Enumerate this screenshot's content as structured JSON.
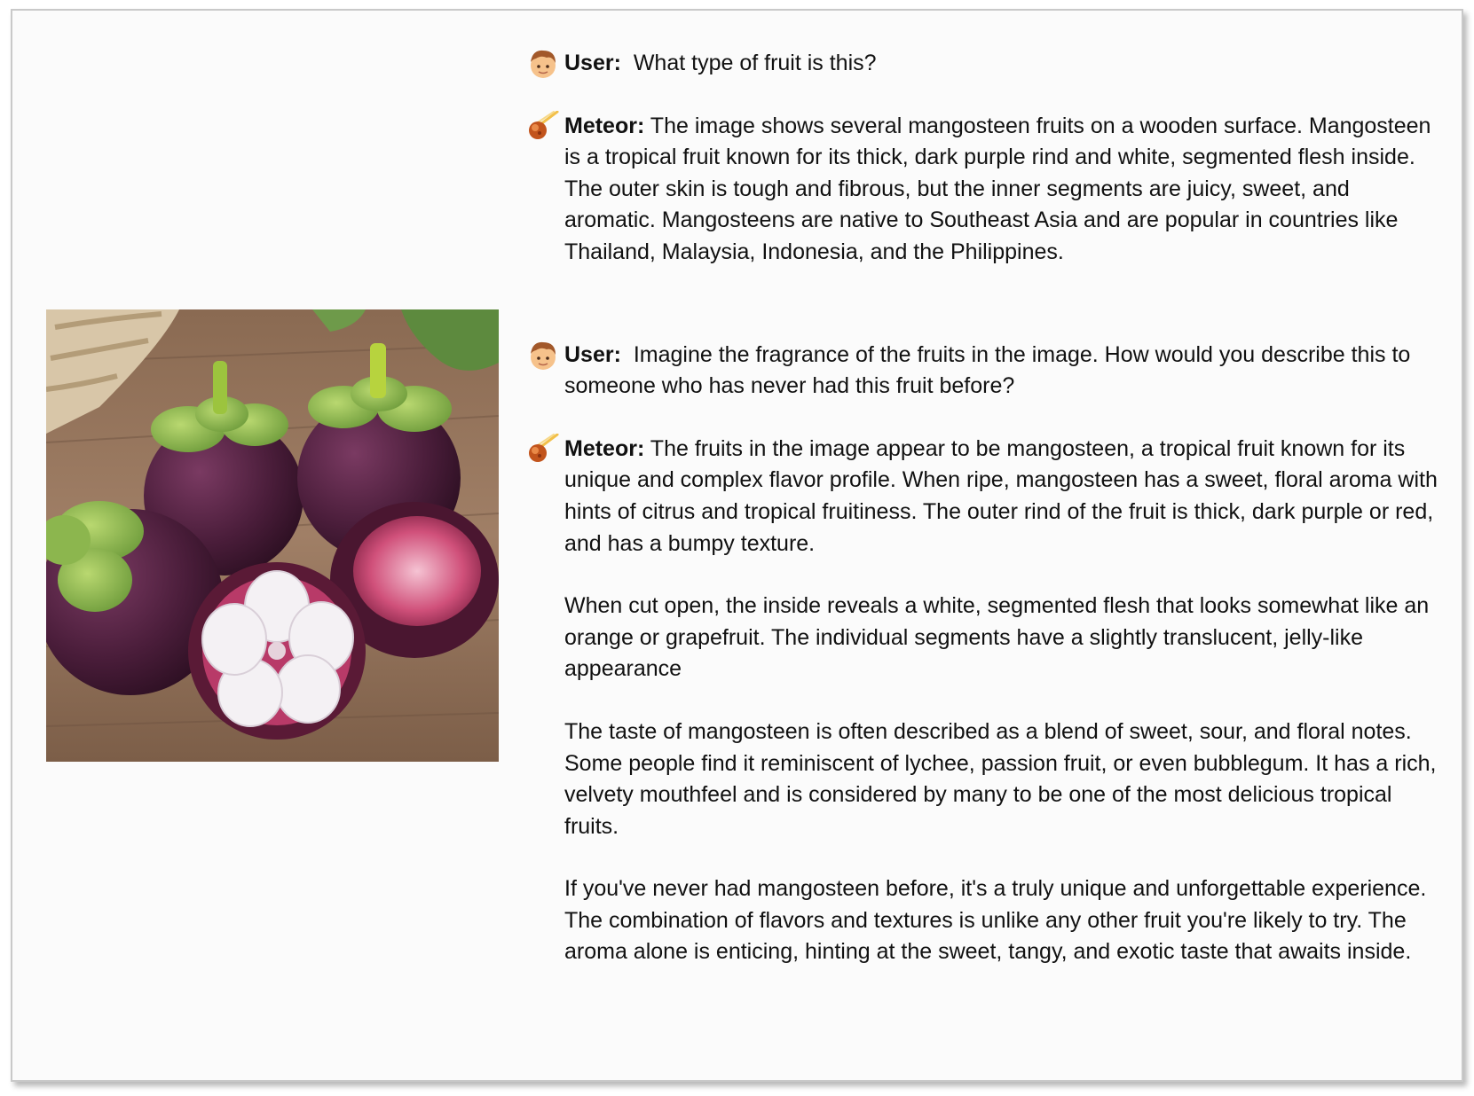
{
  "conversation": {
    "turn1": {
      "user_speaker": "User:",
      "user_text": "What type of fruit is this?",
      "assistant_speaker": "Meteor:",
      "assistant_p1": "The image shows several mangosteen fruits on a wooden surface. Mangosteen is a tropical fruit known for its thick, dark purple rind and white, segmented flesh inside. The outer skin is tough and fibrous, but the inner segments are juicy, sweet, and aromatic. Mangosteens are native to Southeast Asia and are popular in countries like Thailand, Malaysia, Indonesia, and the Philippines."
    },
    "turn2": {
      "user_speaker": "User:",
      "user_text": "Imagine the fragrance of the fruits in the image. How would you describe this to someone who has never had this fruit before?",
      "assistant_speaker": "Meteor:",
      "assistant_p1": "The fruits in the image appear to be mangosteen, a tropical fruit known for its unique and complex flavor profile. When ripe, mangosteen has a sweet, floral aroma with hints of citrus and tropical fruitiness. The outer rind of the fruit is thick, dark purple or red, and has a bumpy texture.",
      "assistant_p2": "When cut open, the inside reveals a white, segmented flesh that looks somewhat like an orange or grapefruit. The individual segments have a slightly translucent, jelly-like appearance",
      "assistant_p3": "The taste of mangosteen is often described as a blend of sweet, sour, and floral notes. Some people find it reminiscent of lychee, passion fruit, or even bubblegum. It has a rich, velvety mouthfeel and is considered by many to be one of the most delicious tropical fruits.",
      "assistant_p4": "If you've never had mangosteen before, it's a truly unique and unforgettable experience. The combination of flavors and textures is unlike any other fruit you're likely to try. The aroma alone is enticing, hinting at the sweet, tangy, and exotic taste that awaits inside."
    }
  },
  "icons": {
    "user": "user-avatar-icon",
    "assistant": "meteor-icon"
  },
  "colors": {
    "text": "#111111",
    "frame_border": "#c9c9c9",
    "background": "#fbfbfb"
  }
}
